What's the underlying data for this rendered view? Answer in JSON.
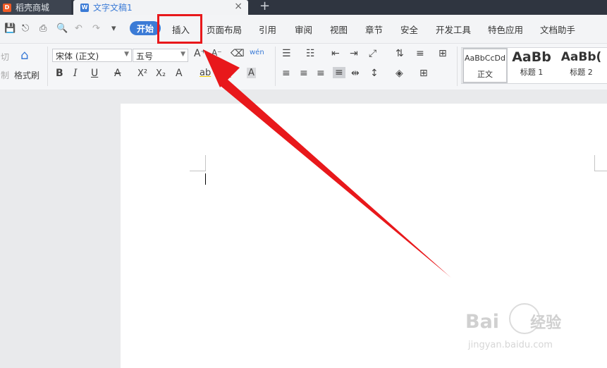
{
  "tabs": {
    "store_label": "稻壳商城",
    "doc_label": "文字文稿1",
    "close_icon": "×",
    "new_tab_icon": "+",
    "store_icon_glyph": "D",
    "doc_icon_glyph": "W"
  },
  "quick_access": {
    "icons": [
      "save-icon",
      "format-painter-icon",
      "print-icon",
      "print-preview-icon",
      "undo-icon",
      "redo-icon",
      "more-icon"
    ],
    "glyphs": [
      "💾",
      "⎋",
      "⎙",
      "🔍",
      "↶",
      "↷",
      "▾"
    ]
  },
  "menu": {
    "start_label": "开始",
    "items": [
      "插入",
      "页面布局",
      "引用",
      "审阅",
      "视图",
      "章节",
      "安全",
      "开发工具",
      "特色应用",
      "文档助手"
    ]
  },
  "ribbon": {
    "cut_label": "切",
    "cut_label_2": "制",
    "format_painter_label": "格式刷",
    "font_name": "宋体 (正文)",
    "font_size": "五号",
    "font_grow_glyph": "A⁺",
    "font_shrink_glyph": "A⁻",
    "clear_format_glyph": "⌫",
    "phonetic_glyph": "wén",
    "bold": "B",
    "italic": "I",
    "underline": "U",
    "strike": "A",
    "superscript": "X²",
    "subscript": "X₂",
    "text_effect": "A",
    "highlight": "ab",
    "font_color": "A",
    "char_shading": "A",
    "styles": [
      {
        "preview": "AaBbCcDd",
        "name": "正文"
      },
      {
        "preview": "AaBb",
        "name": "标题 1"
      },
      {
        "preview": "AaBb(",
        "name": "标题 2"
      }
    ]
  },
  "watermark": {
    "brand": "Bai",
    "brand_tail": "经验",
    "url": "jingyan.baidu.com"
  },
  "colors": {
    "accent": "#3b7bd6",
    "highlight_red": "#e8181b",
    "tabbar": "#2f3540"
  }
}
